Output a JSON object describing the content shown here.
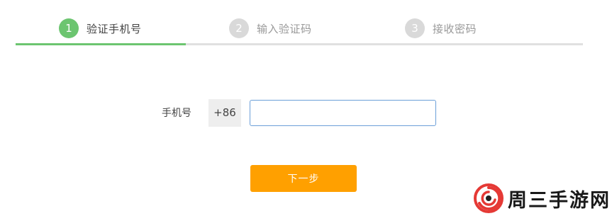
{
  "steps": [
    {
      "number": "1",
      "label": "验证手机号",
      "state": "active"
    },
    {
      "number": "2",
      "label": "输入验证码",
      "state": "inactive"
    },
    {
      "number": "3",
      "label": "接收密码",
      "state": "inactive"
    }
  ],
  "form": {
    "phone_label": "手机号",
    "country_code": "+86",
    "phone_value": "",
    "phone_placeholder": ""
  },
  "actions": {
    "next_label": "下一步"
  },
  "watermark": {
    "text": "周三手游网",
    "logo_icon": "swirl-logo-icon"
  },
  "colors": {
    "active_step": "#6cc570",
    "inactive_step": "#d9d9d9",
    "primary_button": "#ffa000",
    "input_focus_border": "#6b9fd8"
  }
}
